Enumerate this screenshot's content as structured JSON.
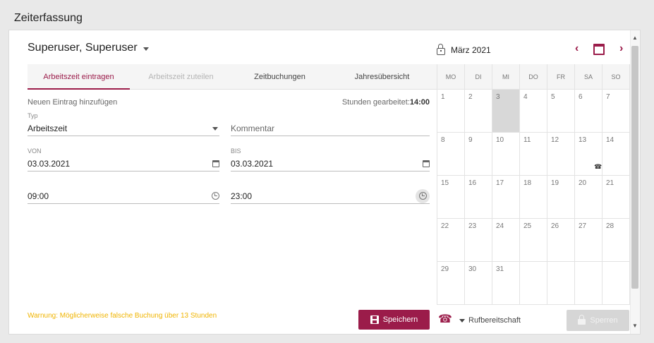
{
  "app": {
    "title": "Zeiterfassung"
  },
  "user": {
    "name": "Superuser, Superuser"
  },
  "tabs": [
    {
      "label": "Arbeitszeit eintragen",
      "state": "active"
    },
    {
      "label": "Arbeitszeit zuteilen",
      "state": "disabled"
    },
    {
      "label": "Zeitbuchungen",
      "state": "normal"
    },
    {
      "label": "Jahresübersicht",
      "state": "normal"
    }
  ],
  "form": {
    "new_entry_label": "Neuen Eintrag hinzufügen",
    "hours_label": "Stunden gearbeitet:",
    "hours_value": "14:00",
    "type": {
      "label": "Typ",
      "value": "Arbeitszeit"
    },
    "comment": {
      "placeholder": "Kommentar"
    },
    "from_date": {
      "label": "VON",
      "value": "03.03.2021"
    },
    "to_date": {
      "label": "BIS",
      "value": "03.03.2021"
    },
    "from_time": {
      "value": "09:00"
    },
    "to_time": {
      "value": "23:00"
    },
    "warning": "Warnung: Möglicherweise falsche Buchung über 13 Stunden"
  },
  "actions": {
    "save": "Speichern",
    "on_call": "Rufbereitschaft",
    "lock": "Sperren"
  },
  "calendar": {
    "month": "März 2021",
    "weekdays": [
      "MO",
      "DI",
      "MI",
      "DO",
      "FR",
      "SA",
      "SO"
    ],
    "weeks": [
      [
        "1",
        "2",
        "3",
        "4",
        "5",
        "6",
        "7"
      ],
      [
        "8",
        "9",
        "10",
        "11",
        "12",
        "13",
        "14"
      ],
      [
        "15",
        "16",
        "17",
        "18",
        "19",
        "20",
        "21"
      ],
      [
        "22",
        "23",
        "24",
        "25",
        "26",
        "27",
        "28"
      ],
      [
        "29",
        "30",
        "31",
        "",
        "",
        "",
        ""
      ]
    ],
    "selected_day": "3",
    "on_call_day": "13"
  },
  "colors": {
    "accent": "#9b1c4a",
    "warning": "#f0b400"
  }
}
